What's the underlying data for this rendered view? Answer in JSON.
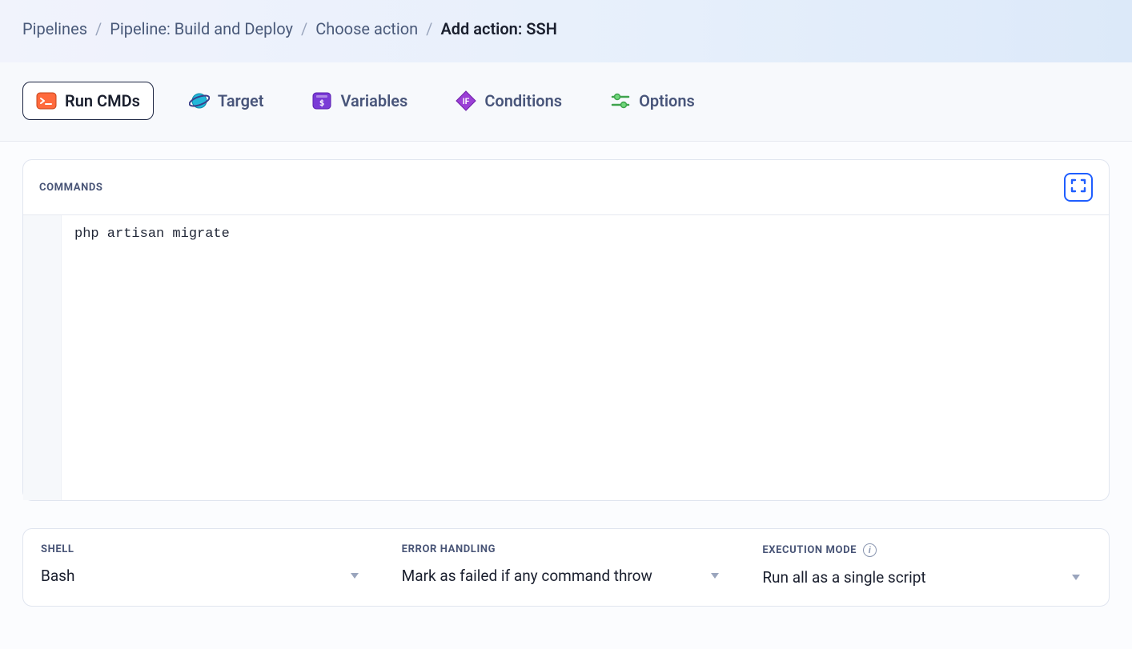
{
  "breadcrumb": {
    "items": [
      {
        "label": "Pipelines"
      },
      {
        "label": "Pipeline: Build and Deploy"
      },
      {
        "label": "Choose action"
      }
    ],
    "current": "Add action: SSH"
  },
  "tabs": {
    "run_cmds": {
      "label": "Run CMDs"
    },
    "target": {
      "label": "Target"
    },
    "variables": {
      "label": "Variables"
    },
    "conditions": {
      "label": "Conditions"
    },
    "options": {
      "label": "Options"
    }
  },
  "commands": {
    "title": "COMMANDS",
    "code": "php artisan migrate"
  },
  "shell": {
    "label": "SHELL",
    "value": "Bash"
  },
  "error_handling": {
    "label": "ERROR HANDLING",
    "value": "Mark as failed if any command throw"
  },
  "execution_mode": {
    "label": "EXECUTION MODE",
    "value": "Run all as a single script"
  }
}
